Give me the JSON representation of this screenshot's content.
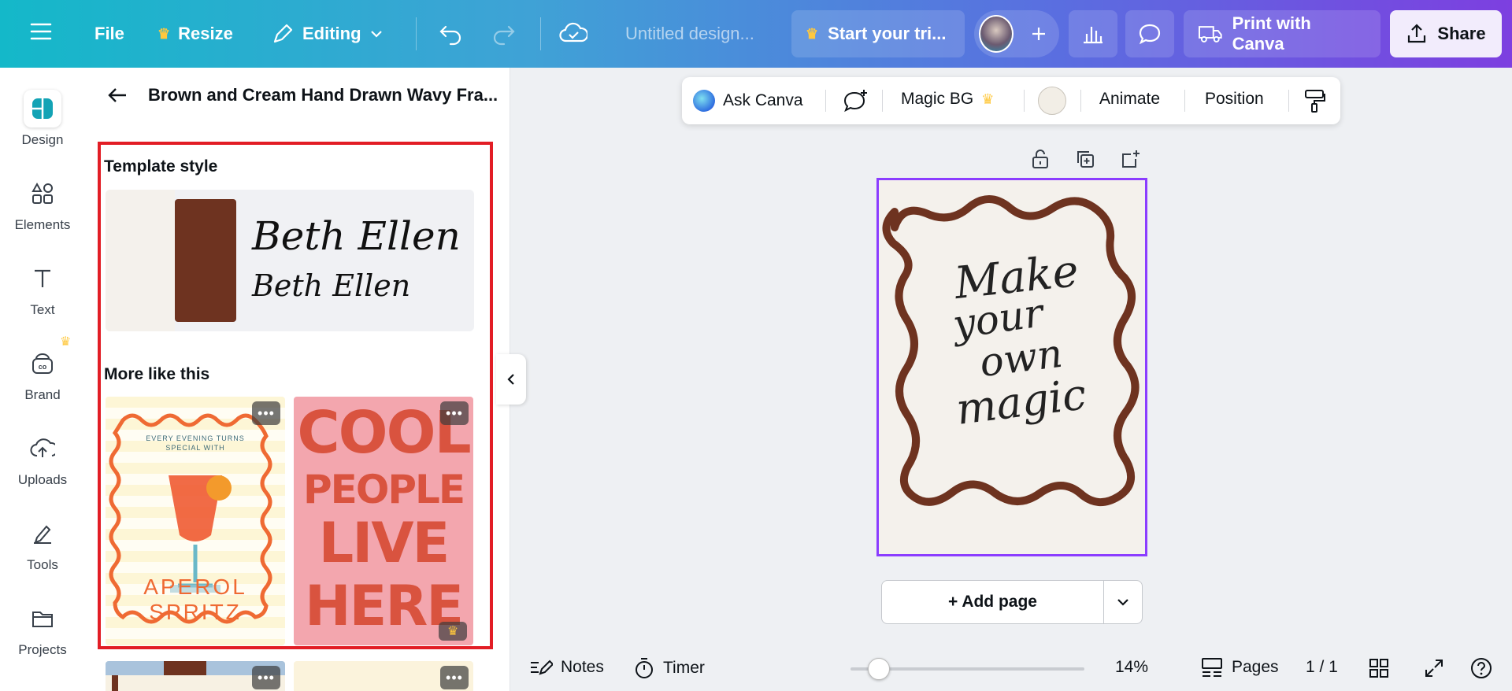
{
  "topbar": {
    "file_label": "File",
    "resize_label": "Resize",
    "editing_label": "Editing",
    "design_title": "Untitled design...",
    "trial_label": "Start your tri...",
    "print_label": "Print with Canva",
    "share_label": "Share"
  },
  "rail": {
    "design": "Design",
    "elements": "Elements",
    "text": "Text",
    "brand": "Brand",
    "uploads": "Uploads",
    "tools": "Tools",
    "projects": "Projects"
  },
  "panel": {
    "title": "Brown and Cream Hand Drawn Wavy Fra...",
    "template_style_heading": "Template style",
    "font_sample_1": "Beth Ellen",
    "font_sample_2": "Beth Ellen",
    "more_like_heading": "More like this",
    "thumb1": {
      "line1": "EVERY EVENING TURNS",
      "line2": "SPECIAL WITH",
      "line3": "APEROL",
      "line4": "SPRITZ"
    },
    "thumb2": {
      "line1": "COOL",
      "line2": "PEOPLE",
      "line3": "LIVE",
      "line4": "HERE"
    },
    "more_glyph": "•••",
    "colors": {
      "brown": "#6e3320",
      "cream": "#f4f1ec",
      "pink": "#f3a6ae",
      "orange": "#ef6a33"
    }
  },
  "context_toolbar": {
    "ask_canva": "Ask Canva",
    "magic_bg": "Magic BG",
    "animate": "Animate",
    "position": "Position"
  },
  "canvas": {
    "line1": "Make",
    "line2": "your",
    "line3": "own",
    "line4": "magic",
    "add_page": "+ Add page"
  },
  "bottom": {
    "notes": "Notes",
    "timer": "Timer",
    "zoom": "14%",
    "zoom_fraction": 0.14,
    "pages": "Pages",
    "page_count": "1 / 1"
  }
}
